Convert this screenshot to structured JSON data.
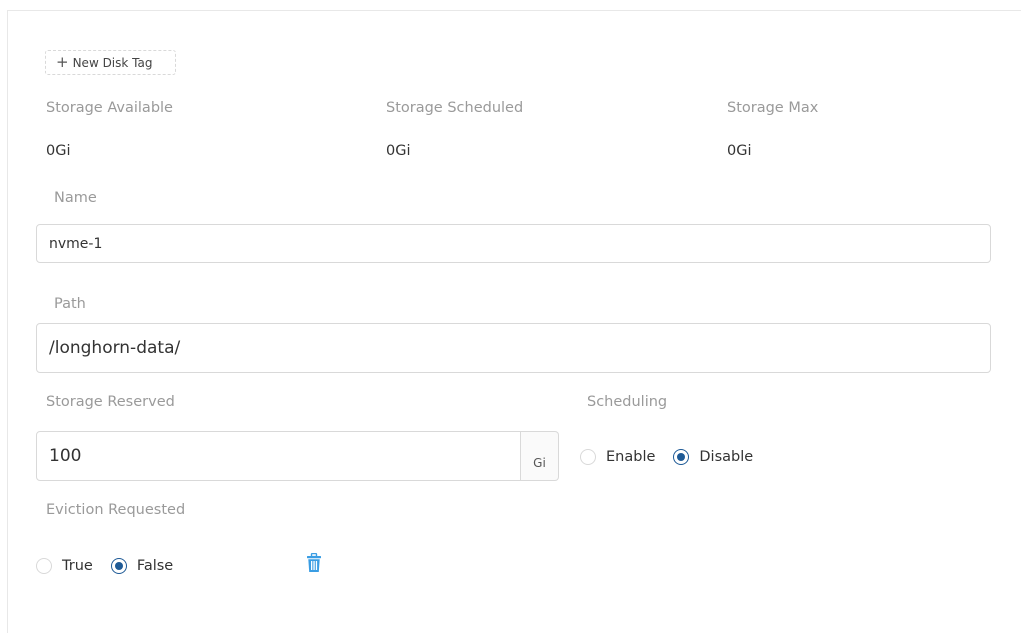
{
  "actions": {
    "new_disk_tag": "New Disk Tag",
    "new_disk_tag_icon": "plus-icon",
    "delete_icon": "trash-icon"
  },
  "stats": {
    "available_label": "Storage Available",
    "available_value": "0Gi",
    "scheduled_label": "Storage Scheduled",
    "scheduled_value": "0Gi",
    "max_label": "Storage Max",
    "max_value": "0Gi"
  },
  "form": {
    "name_label": "Name",
    "name_value": "nvme-1",
    "path_label": "Path",
    "path_value": "/longhorn-data/",
    "reserved_label": "Storage Reserved",
    "reserved_value": "100",
    "reserved_unit": "Gi",
    "scheduling_label": "Scheduling",
    "scheduling_options": [
      "Enable",
      "Disable"
    ],
    "scheduling_selected": "Disable",
    "eviction_label": "Eviction Requested",
    "eviction_options": [
      "True",
      "False"
    ],
    "eviction_selected": "False"
  },
  "colors": {
    "accent": "#1e5a96",
    "icon_blue": "#3a9de3"
  }
}
